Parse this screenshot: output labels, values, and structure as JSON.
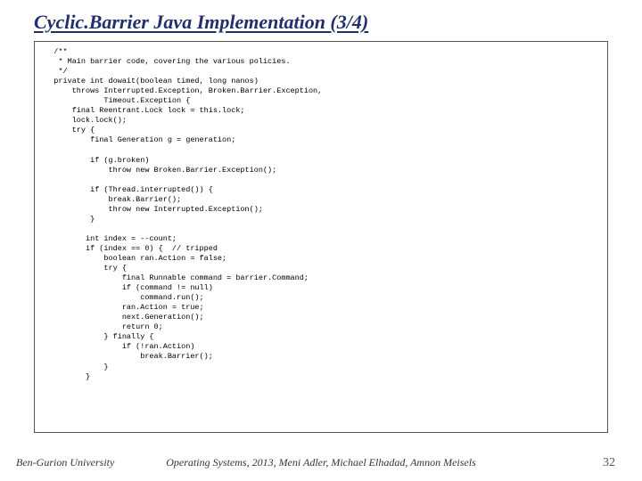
{
  "title": "Cyclic.Barrier Java Implementation (3/4)",
  "code": "   /**\n    * Main barrier code, covering the various policies.\n    */\n   private int dowait(boolean timed, long nanos)\n       throws Interrupted.Exception, Broken.Barrier.Exception,\n              Timeout.Exception {\n       final Reentrant.Lock lock = this.lock;\n       lock.lock();\n       try {\n           final Generation g = generation;\n\n           if (g.broken)\n               throw new Broken.Barrier.Exception();\n\n           if (Thread.interrupted()) {\n               break.Barrier();\n               throw new Interrupted.Exception();\n           }\n\n          int index = --count;\n          if (index == 0) {  // tripped\n              boolean ran.Action = false;\n              try {\n                  final Runnable command = barrier.Command;\n                  if (command != null)\n                      command.run();\n                  ran.Action = true;\n                  next.Generation();\n                  return 0;\n              } finally {\n                  if (!ran.Action)\n                      break.Barrier();\n              }\n          }",
  "footer": {
    "left": "Ben-Gurion University",
    "center": "Operating Systems, 2013, Meni Adler, Michael Elhadad, Amnon Meisels",
    "page": "32"
  }
}
